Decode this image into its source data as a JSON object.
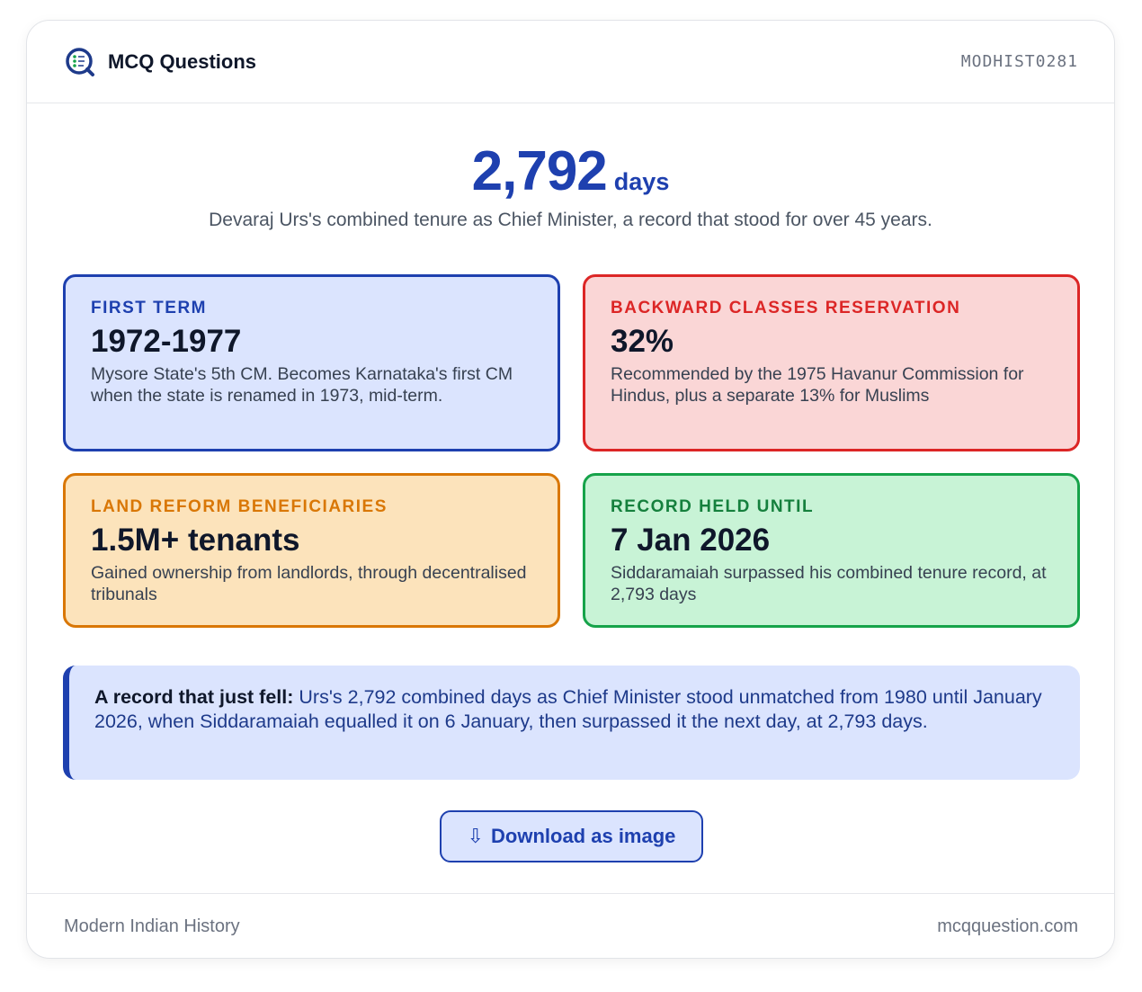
{
  "header": {
    "brand_name": "MCQ Questions",
    "code": "MODHIST0281",
    "logo_icon": "quiz-magnifier-icon"
  },
  "hero": {
    "number": "2,792",
    "unit": "days",
    "caption": "Devaraj Urs's combined tenure as Chief Minister, a record that stood for over 45 years."
  },
  "stats": [
    {
      "label": "FIRST TERM",
      "value": "1972-1977",
      "description": "Mysore State's 5th CM. Becomes Karnataka's first CM when the state is renamed in 1973, mid-term.",
      "accent": "#1e40af",
      "background": "#dbe4fe"
    },
    {
      "label": "BACKWARD CLASSES RESERVATION",
      "value": "32%",
      "description": "Recommended by the 1975 Havanur Commission for Hindus, plus a separate 13% for Muslims",
      "accent": "#dc2626",
      "background": "#fad6d6"
    },
    {
      "label": "LAND REFORM BENEFICIARIES",
      "value": "1.5M+ tenants",
      "description": "Gained ownership from landlords, through decentralised tribunals",
      "accent": "#d97706",
      "background": "#fce3bb"
    },
    {
      "label": "RECORD HELD UNTIL",
      "value": "7 Jan 2026",
      "description": "Siddaramaiah surpassed his combined tenure record, at 2,793 days",
      "accent": "#16a34a",
      "background": "#c8f3d6"
    }
  ],
  "note": {
    "lead": "A record that just fell:",
    "text": " Urs's 2,792 combined days as Chief Minister stood unmatched from 1980 until January 2026, when Siddaramaiah equalled it on 6 January, then surpassed it the next day, at 2,793 days."
  },
  "download": {
    "icon": "⇩",
    "label": "Download as image"
  },
  "footer": {
    "category": "Modern Indian History",
    "site": "mcqquestion.com"
  }
}
